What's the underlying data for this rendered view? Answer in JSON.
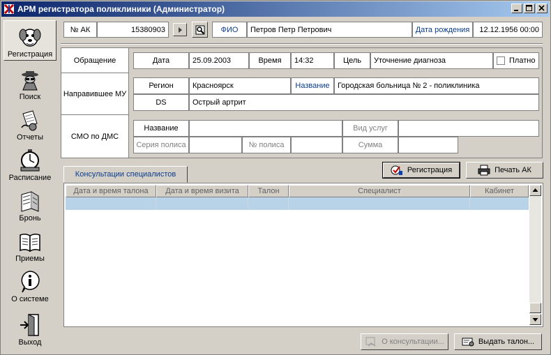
{
  "window": {
    "title": "АРМ регистратора поликлиники (Администратор)",
    "controls": [
      "minimize",
      "maximize",
      "close"
    ]
  },
  "sidebar": {
    "items": [
      {
        "label": "Регистрация",
        "icon": "registration-dog-icon",
        "active": true
      },
      {
        "label": "Поиск",
        "icon": "search-detective-icon"
      },
      {
        "label": "Отчеты",
        "icon": "reports-icon"
      },
      {
        "label": "Расписание",
        "icon": "schedule-clock-icon"
      },
      {
        "label": "Бронь",
        "icon": "booking-icon"
      },
      {
        "label": "Приемы",
        "icon": "appointments-book-icon"
      },
      {
        "label": "О системе",
        "icon": "info-icon"
      },
      {
        "label": "Выход",
        "icon": "exit-icon"
      }
    ]
  },
  "patient": {
    "ak_label": "№ АК",
    "ak_value": "15380903",
    "fio_label": "ФИО",
    "fio_value": "Петров Петр Петрович",
    "dob_label": "Дата рождения",
    "dob_value": "12.12.1956 00:00"
  },
  "appeal": {
    "section_label": "Обращение",
    "date_label": "Дата",
    "date_value": "25.09.2003",
    "time_label": "Время",
    "time_value": "14:32",
    "goal_label": "Цель",
    "goal_value": "Уточнение диагноза",
    "paid_label": "Платно",
    "paid_checked": false
  },
  "referral": {
    "section_label": "Направившее МУ",
    "region_label": "Регион",
    "region_value": "Красноярск",
    "name_label": "Название",
    "name_value": "Городская больница № 2 - поликлиника",
    "ds_label": "DS",
    "ds_value": "Острый артрит"
  },
  "insurance": {
    "section_label": "СМО по ДМС",
    "name_label": "Название",
    "name_value": "",
    "service_label": "Вид услуг",
    "service_value": "",
    "series_label": "Серия полиса",
    "series_value": "",
    "number_label": "№ полиса",
    "number_value": "",
    "sum_label": "Сумма",
    "sum_value": ""
  },
  "actions": {
    "register_label": "Регистрация",
    "print_label": "Печать АК",
    "consult_label": "О консультации...",
    "issue_label": "Выдать талон..."
  },
  "consultations": {
    "tab_label": "Консультации специалистов",
    "columns": [
      "Дата и время талона",
      "Дата и время визита",
      "Талон",
      "Специалист",
      "Кабинет"
    ]
  },
  "colors": {
    "title_gradient_start": "#0a246a",
    "title_gradient_end": "#a6caf0",
    "label_blue": "#0a3c8c",
    "selected_row": "#b8d3e8"
  }
}
